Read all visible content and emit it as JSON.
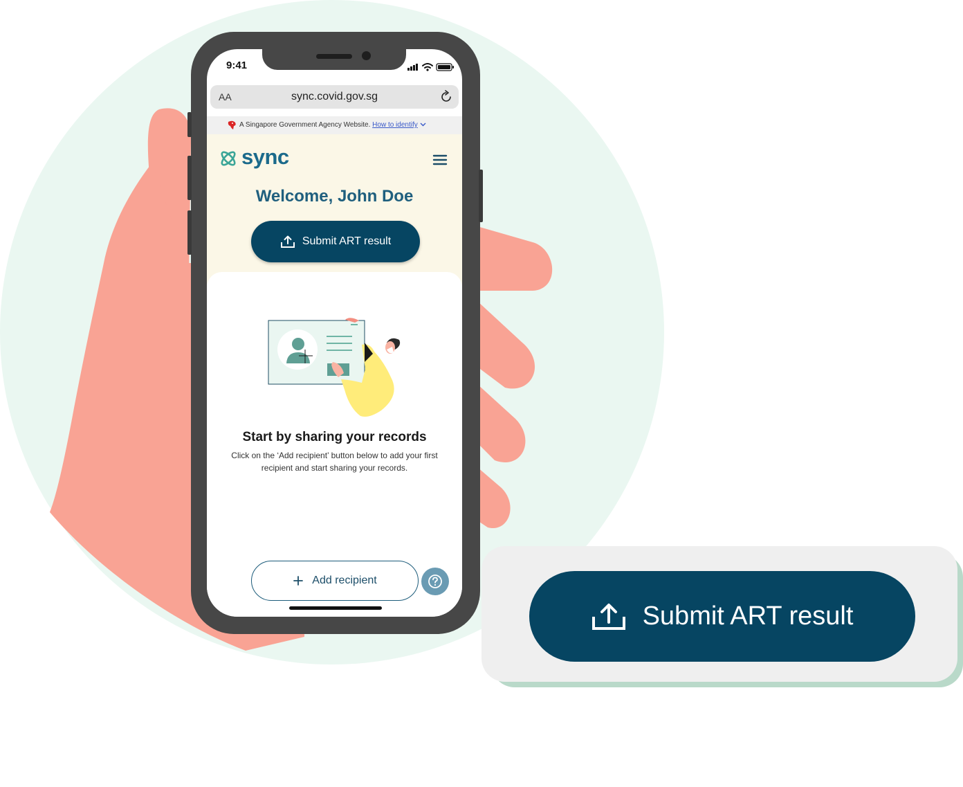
{
  "status_bar": {
    "time": "9:41"
  },
  "browser": {
    "text_size_label": "AA",
    "url": "sync.covid.gov.sg"
  },
  "gov_banner": {
    "text": "A Singapore Government Agency Website.",
    "link": "How to identify"
  },
  "app": {
    "logo_text": "sync",
    "welcome": "Welcome, John Doe",
    "submit_label": "Submit ART result",
    "empty_title": "Start by sharing your records",
    "empty_desc": "Click on the ‘Add recipient’ button below to add your first recipient and start sharing your records.",
    "add_recipient_label": "Add recipient"
  },
  "callout": {
    "submit_label": "Submit ART result"
  },
  "icons": [
    "upload-icon",
    "plus-icon",
    "help-icon",
    "menu-icon",
    "reload-icon",
    "lion-icon",
    "chevron-down-icon",
    "sync-logo-icon"
  ],
  "colors": {
    "primary": "#064562",
    "brand_text": "#1b6a8b",
    "hero_bg": "#fbf7e7",
    "circle_bg": "#eaf7f1",
    "hand": "#f9a394",
    "callout_shadow": "#b9d9c9",
    "help": "#6a9bb3"
  }
}
